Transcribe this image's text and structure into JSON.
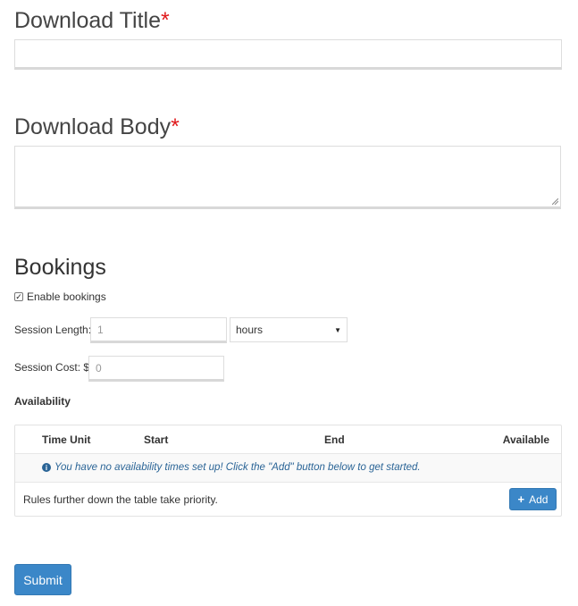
{
  "download_title": {
    "label": "Download Title",
    "required": "*",
    "value": ""
  },
  "download_body": {
    "label": "Download Body",
    "required": "*",
    "value": ""
  },
  "bookings": {
    "heading": "Bookings",
    "enable_label": "Enable bookings",
    "enable_checked": true,
    "session_length": {
      "label": "Session Length:",
      "value": "1",
      "unit_selected": "hours"
    },
    "session_cost": {
      "label": "Session Cost: $",
      "value": "0"
    },
    "availability": {
      "heading": "Availability",
      "columns": [
        "Time Unit",
        "Start",
        "End",
        "Available"
      ],
      "empty_message": "You have no availability times set up! Click the \"Add\" button below to get started.",
      "footer_note": "Rules further down the table take priority.",
      "add_label": "Add"
    }
  },
  "submit_label": "Submit"
}
